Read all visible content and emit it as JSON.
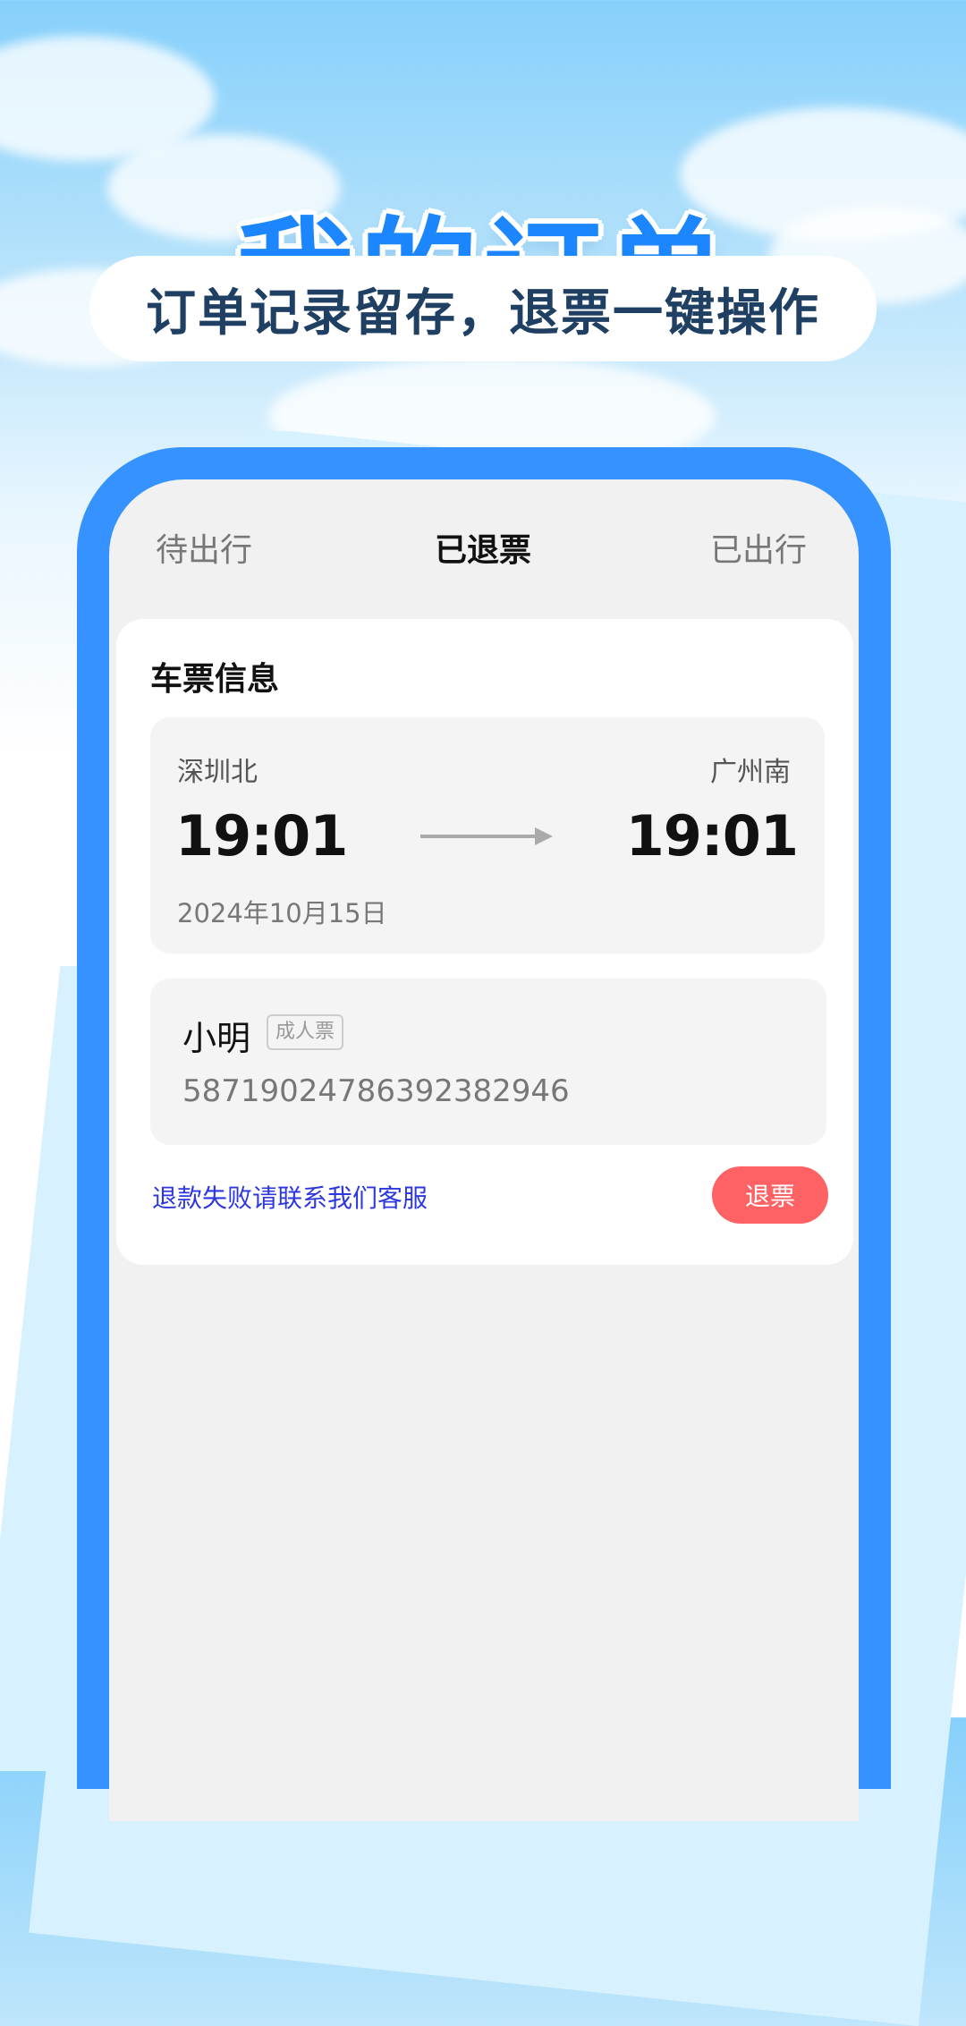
{
  "hero": {
    "title": "我的订单",
    "subtitle": "订单记录留存，退票一键操作"
  },
  "tabs": [
    {
      "label": "待出行",
      "active": false
    },
    {
      "label": "已退票",
      "active": true
    },
    {
      "label": "已出行",
      "active": false
    }
  ],
  "ticket": {
    "section_title": "车票信息",
    "from_station": "深圳北",
    "to_station": "广州南",
    "depart_time": "19:01",
    "arrive_time": "19:01",
    "date": "2024年10月15日"
  },
  "passenger": {
    "name": "小明",
    "ticket_type": "成人票",
    "id_number": "587190247863923829​46"
  },
  "actions": {
    "help_text": "退款失败请联系我们客服",
    "refund_label": "退票"
  },
  "colors": {
    "primary": "#3592ff",
    "title_blue": "#1c86ff",
    "refund_red": "#ff6265",
    "link_blue": "#2d37df"
  },
  "icons": {
    "arrow": "right-arrow-icon"
  }
}
